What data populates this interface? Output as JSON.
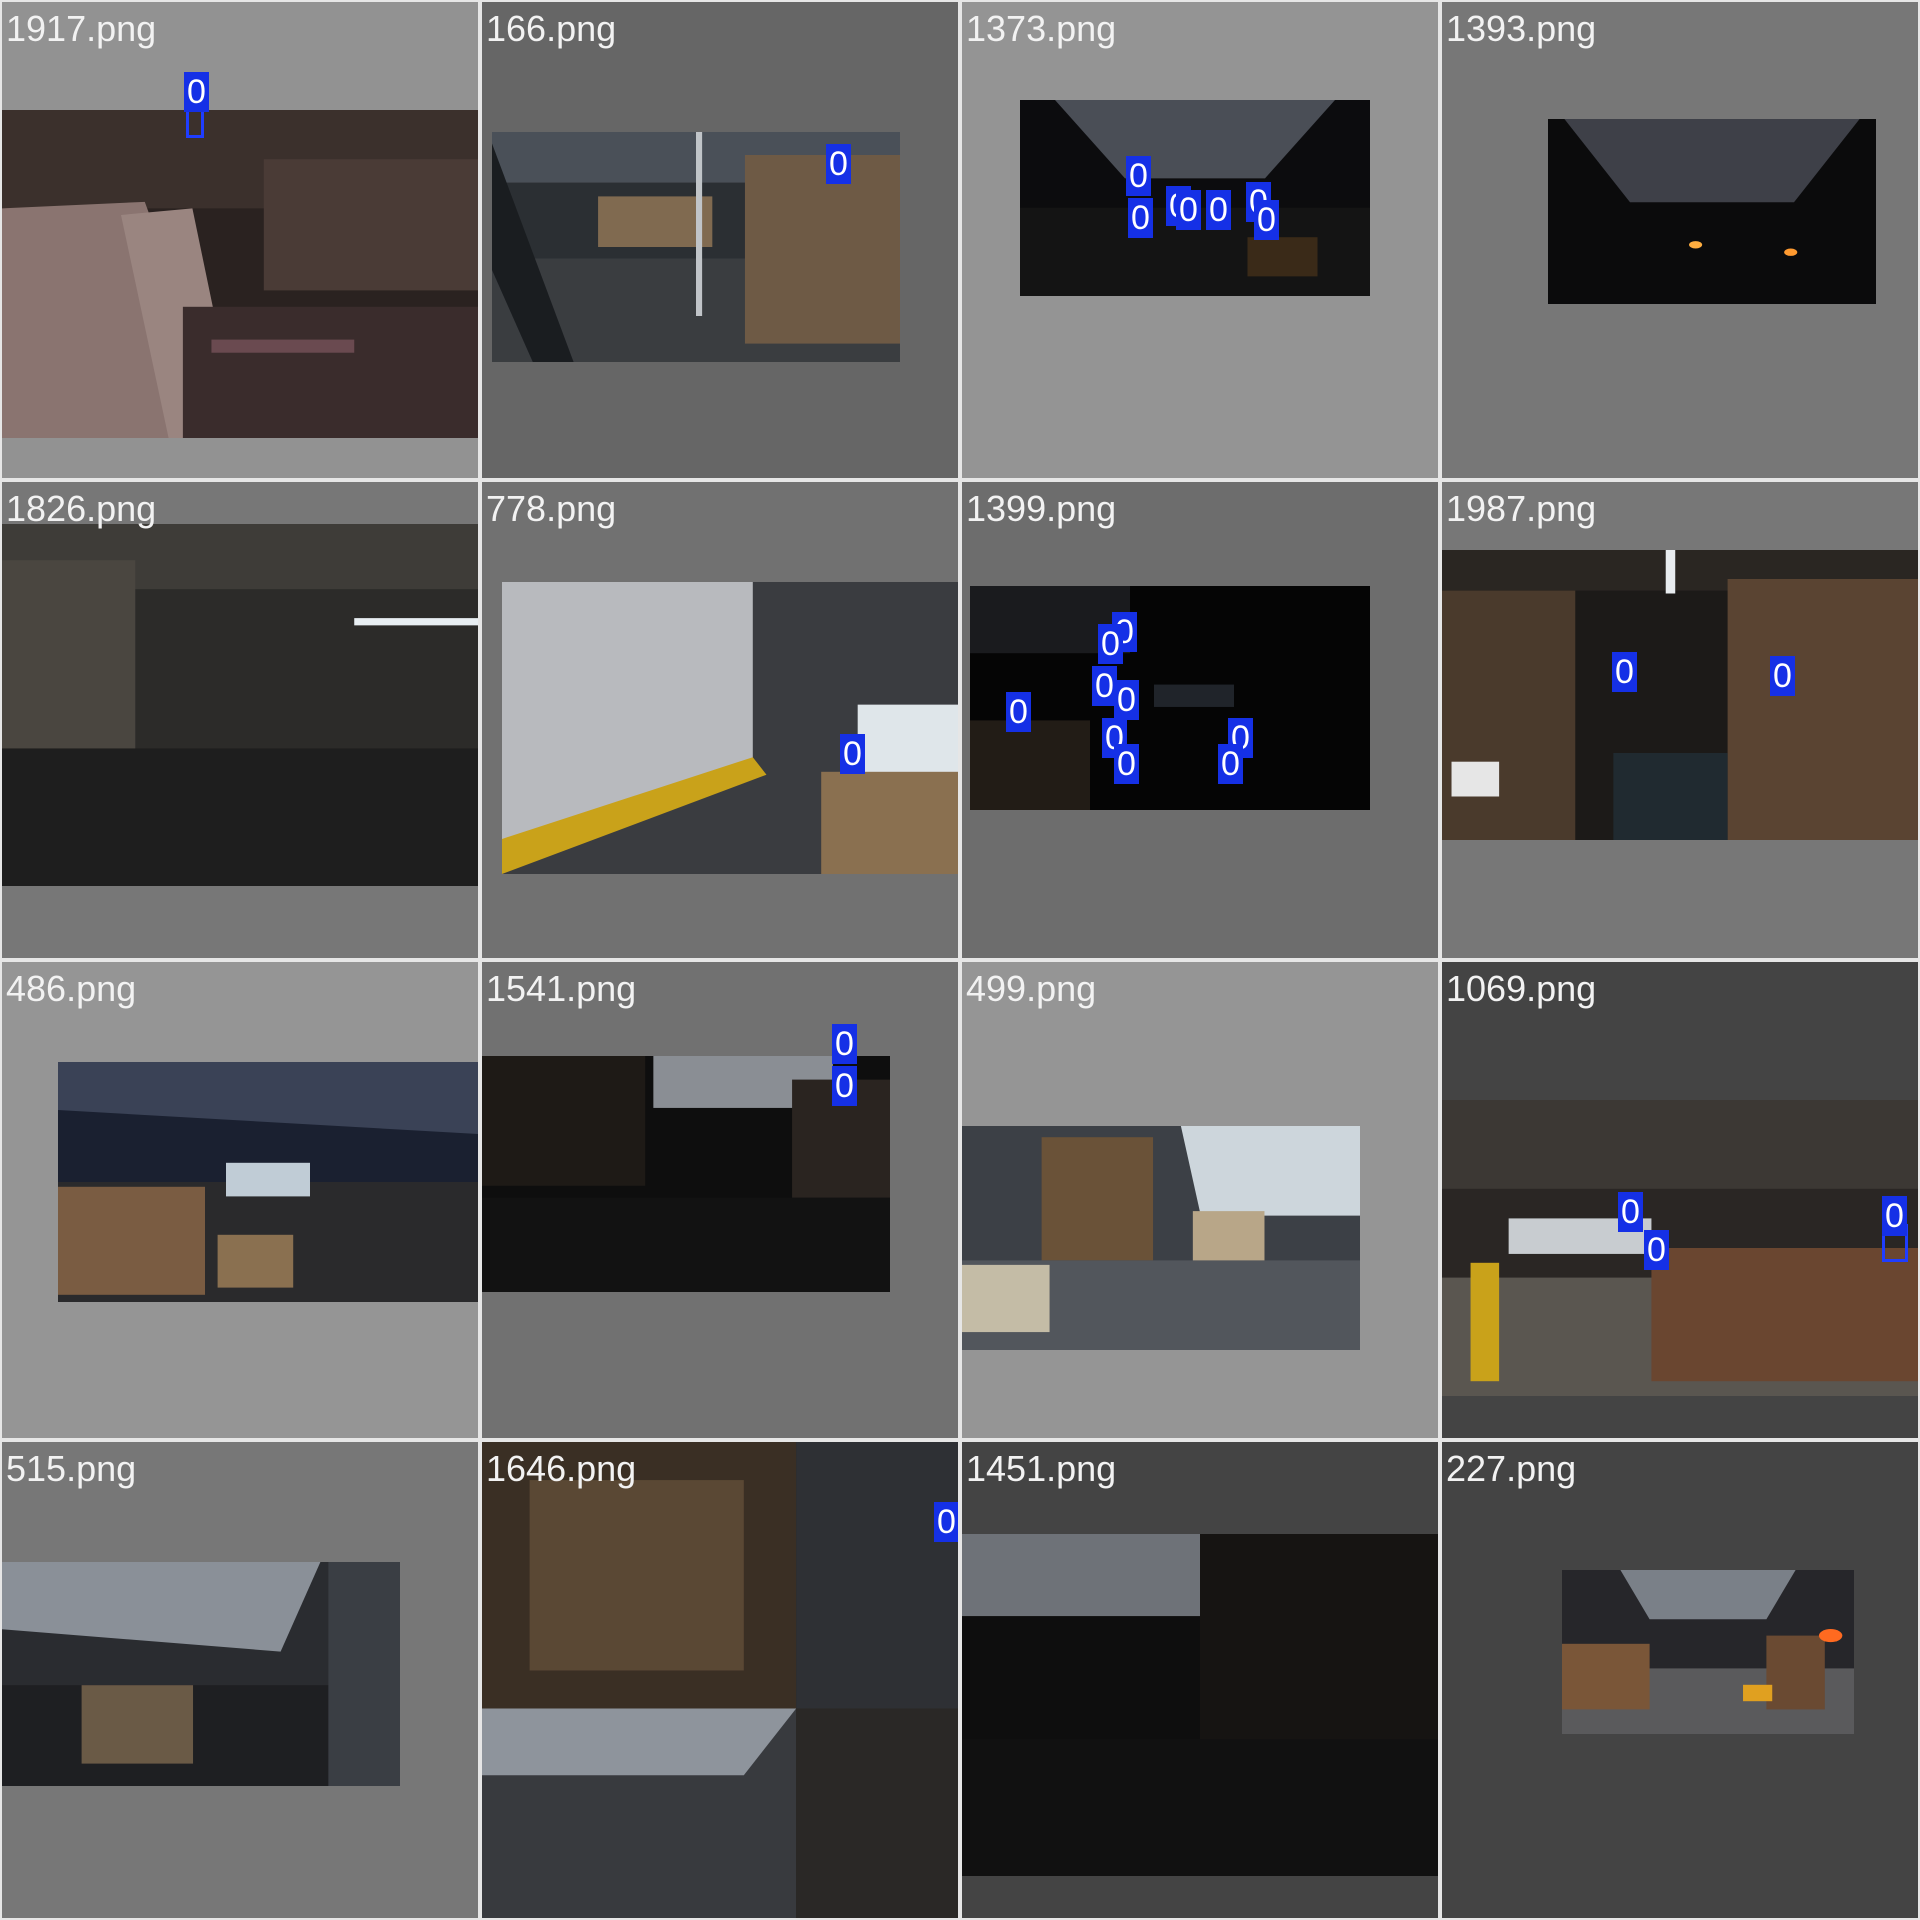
{
  "colors": {
    "detection_box": "#1f3dff",
    "detection_label_bg": "#1530e6",
    "label_text": "#ffffff",
    "filename_text": "#f2f2f2"
  },
  "tiles": [
    {
      "filename": "1917.png",
      "detections": [
        "0"
      ]
    },
    {
      "filename": "166.png",
      "detections": [
        "0"
      ]
    },
    {
      "filename": "1373.png",
      "detections": [
        "0",
        "0",
        "0",
        "0",
        "0",
        "0",
        "0"
      ]
    },
    {
      "filename": "1393.png",
      "detections": []
    },
    {
      "filename": "1826.png",
      "detections": []
    },
    {
      "filename": "778.png",
      "detections": [
        "0"
      ]
    },
    {
      "filename": "1399.png",
      "detections": [
        "0",
        "0",
        "0",
        "0",
        "0",
        "0",
        "0",
        "0",
        "0"
      ]
    },
    {
      "filename": "1987.png",
      "detections": [
        "0",
        "0"
      ]
    },
    {
      "filename": "486.png",
      "detections": []
    },
    {
      "filename": "1541.png",
      "detections": [
        "0",
        "0"
      ]
    },
    {
      "filename": "499.png",
      "detections": []
    },
    {
      "filename": "1069.png",
      "detections": [
        "0",
        "0",
        "0"
      ]
    },
    {
      "filename": "515.png",
      "detections": []
    },
    {
      "filename": "1646.png",
      "detections": [
        "0"
      ]
    },
    {
      "filename": "1451.png",
      "detections": []
    },
    {
      "filename": "227.png",
      "detections": []
    }
  ]
}
